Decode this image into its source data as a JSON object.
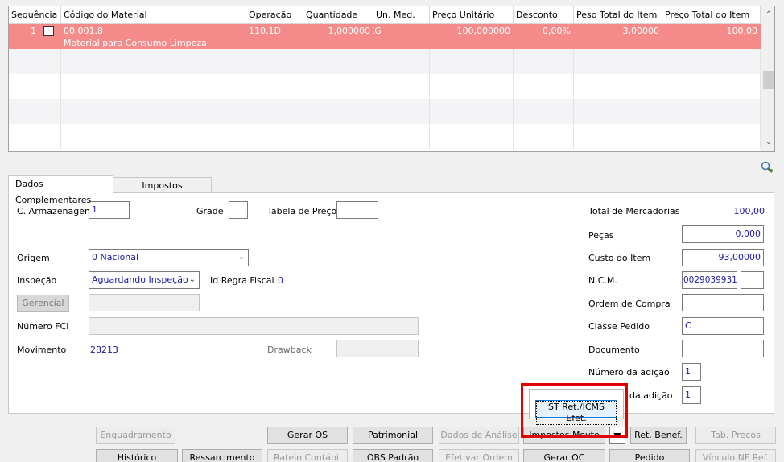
{
  "grid": {
    "columns": [
      "Sequência",
      "Código do Material",
      "Operação",
      "Quantidade",
      "Un. Med.",
      "Preço Unitário",
      "Desconto",
      "Peso Total do Item",
      "Preço Total do Item"
    ],
    "rows": [
      {
        "seq": "1",
        "codigo": "00.001.8",
        "descricao": "Material para Consumo Limpeza",
        "operacao": "110.1D",
        "quantidade": "1,000000",
        "unidade": "KG",
        "preco_unitario": "100,000000",
        "desconto": "0,00%",
        "peso_total": "3,00000",
        "preco_total": "100,00"
      }
    ]
  },
  "tabs": [
    "Dados Complementares",
    "Impostos"
  ],
  "form": {
    "c_armazenagem_label": "C. Armazenagem",
    "c_armazenagem_value": "1",
    "grade_label": "Grade",
    "tabela_preco_label": "Tabela de Preço",
    "origem_label": "Origem",
    "origem_value": "0 Nacional",
    "inspecao_label": "Inspeção",
    "inspecao_value": "Aguardando Inspeção",
    "id_regra_label": "Id Regra Fiscal",
    "id_regra_value": "0",
    "gerencial_label": "Gerencial",
    "numero_fci_label": "Número FCI",
    "movimento_label": "Movimento",
    "movimento_value": "28213",
    "drawback_label": "Drawback",
    "total_mercadorias_label": "Total de Mercadorias",
    "total_mercadorias_value": "100,00",
    "pecas_label": "Peças",
    "pecas_value": "0,000",
    "custo_item_label": "Custo do Item",
    "custo_item_value": "93,00000",
    "ncm_label": "N.C.M.",
    "ncm_value": "0029039931",
    "ordem_compra_label": "Ordem de Compra",
    "classe_pedido_label": "Classe Pedido",
    "classe_pedido_value": "C",
    "documento_label": "Documento",
    "numero_adicao_label": "Número da adição",
    "numero_adicao_value": "1",
    "item_adicao_label_partial": "da adição",
    "item_adicao_value": "1"
  },
  "buttons_row1": [
    "Enguadramento",
    "Gerar OS",
    "Patrimonial",
    "Dados de Análise",
    "Impostos Movto",
    "Ret. Benef.",
    "Tab. Preços"
  ],
  "buttons_row2": [
    "Histórico",
    "Ressarcimento",
    "Rateio Contábil",
    "OBS Padrão",
    "Efetivar Ordem",
    "Gerar OC",
    "Pedido",
    "Vínculo NF Ref."
  ],
  "popup": {
    "item": "ST Ret./ICMS Efet."
  },
  "icons": [
    "checkbox-icon",
    "scroll-up-icon",
    "scroll-down-icon",
    "zoom-icon",
    "dropdown-arrow-icon"
  ],
  "colors": {
    "selected_row": "#f58a8a",
    "value_text": "#1a1aa6",
    "highlight": "#e00000"
  }
}
